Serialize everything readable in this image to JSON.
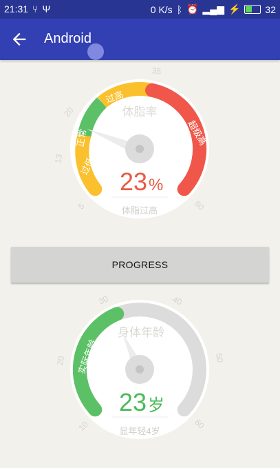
{
  "status": {
    "time": "21:31",
    "net": "0 K/s",
    "battery": "32"
  },
  "appbar": {
    "title": "Android"
  },
  "gauge1": {
    "ticks": [
      "5",
      "13",
      "20",
      "35",
      "60"
    ],
    "segments": [
      "过低",
      "正常",
      "过高",
      "超级高"
    ],
    "title": "体脂率",
    "value": "23",
    "unit": "%",
    "caption": "体脂过高",
    "colors": {
      "low": "#fbc02d",
      "normal": "#5cc166",
      "high": "#fbc02d",
      "veryhigh": "#f0574a",
      "value": "#e85a43"
    }
  },
  "progress_button": {
    "label": "PROGRESS"
  },
  "gauge2": {
    "ticks": [
      "10",
      "20",
      "30",
      "40",
      "50",
      "60"
    ],
    "arc_label": "实际年龄",
    "title": "身体年龄",
    "value": "23",
    "unit": "岁",
    "caption": "显年轻4岁",
    "colors": {
      "progress": "#5cc166",
      "track": "#dcdcdc",
      "value": "#4aba58"
    }
  }
}
